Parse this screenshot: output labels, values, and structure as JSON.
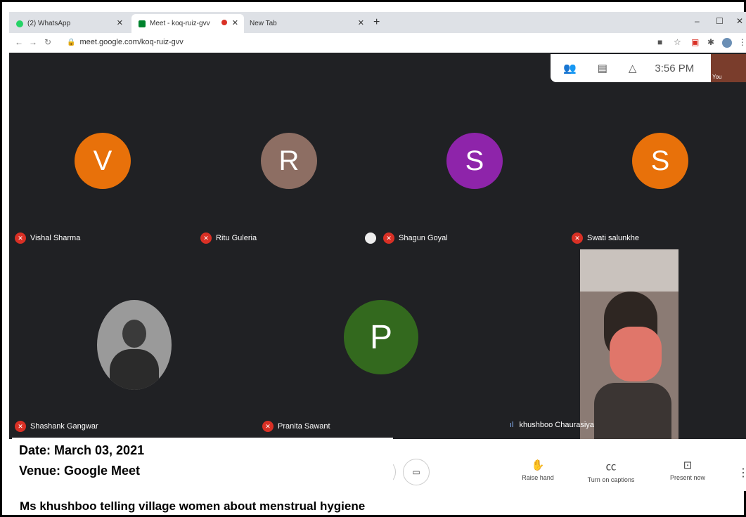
{
  "browser": {
    "tabs": [
      {
        "label": "(2) WhatsApp"
      },
      {
        "label": "Meet - koq-ruiz-gvv"
      },
      {
        "label": "New Tab"
      }
    ],
    "url": "meet.google.com/koq-ruiz-gvv"
  },
  "meet": {
    "time": "3:56 PM",
    "self_label": "You",
    "participants": [
      {
        "initial": "V",
        "name": "Vishal Sharma",
        "color": "#e8710a"
      },
      {
        "initial": "R",
        "name": "Ritu Guleria",
        "color": "#8d6e63"
      },
      {
        "initial": "S",
        "name": "Shagun Goyal",
        "color": "#8e24aa"
      },
      {
        "initial": "S",
        "name": "Swati salunkhe",
        "color": "#e8710a"
      },
      {
        "initial": "",
        "name": "Shashank Gangwar",
        "color": "#9a9a9a"
      },
      {
        "initial": "P",
        "name": "Pranita Sawant",
        "color": "#33691e"
      },
      {
        "initial": "",
        "name": "khushboo Chaurasiya",
        "color": "#8b7b74"
      }
    ],
    "controls": {
      "raise_hand": "Raise hand",
      "captions": "Turn on captions",
      "present": "Present now"
    }
  },
  "overlay": {
    "date": "Date: March 03, 2021",
    "venue": "Venue: Google Meet",
    "caption": "Ms khushboo telling village women about menstrual hygiene"
  }
}
